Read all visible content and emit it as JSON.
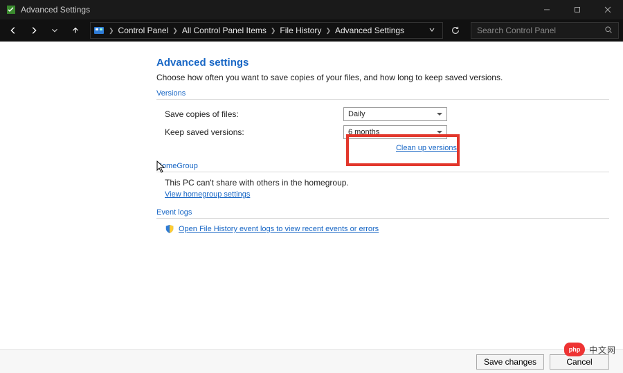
{
  "window": {
    "title": "Advanced Settings"
  },
  "breadcrumb": {
    "items": [
      "Control Panel",
      "All Control Panel Items",
      "File History",
      "Advanced Settings"
    ]
  },
  "search": {
    "placeholder": "Search Control Panel"
  },
  "page": {
    "heading": "Advanced settings",
    "instruction": "Choose how often you want to save copies of your files, and how long to keep saved versions."
  },
  "versions": {
    "section_title": "Versions",
    "save_copies_label": "Save copies of files:",
    "save_copies_value": "Daily",
    "keep_versions_label": "Keep saved versions:",
    "keep_versions_value": "6 months",
    "cleanup_link": "Clean up versions"
  },
  "homegroup": {
    "section_title": "HomeGroup",
    "body": "This PC can't share with others in the homegroup.",
    "link": "View homegroup settings"
  },
  "eventlogs": {
    "section_title": "Event logs",
    "link": "Open File History event logs to view recent events or errors"
  },
  "buttons": {
    "save": "Save changes",
    "cancel": "Cancel"
  },
  "watermark": {
    "logo": "php",
    "text": "中文网"
  }
}
